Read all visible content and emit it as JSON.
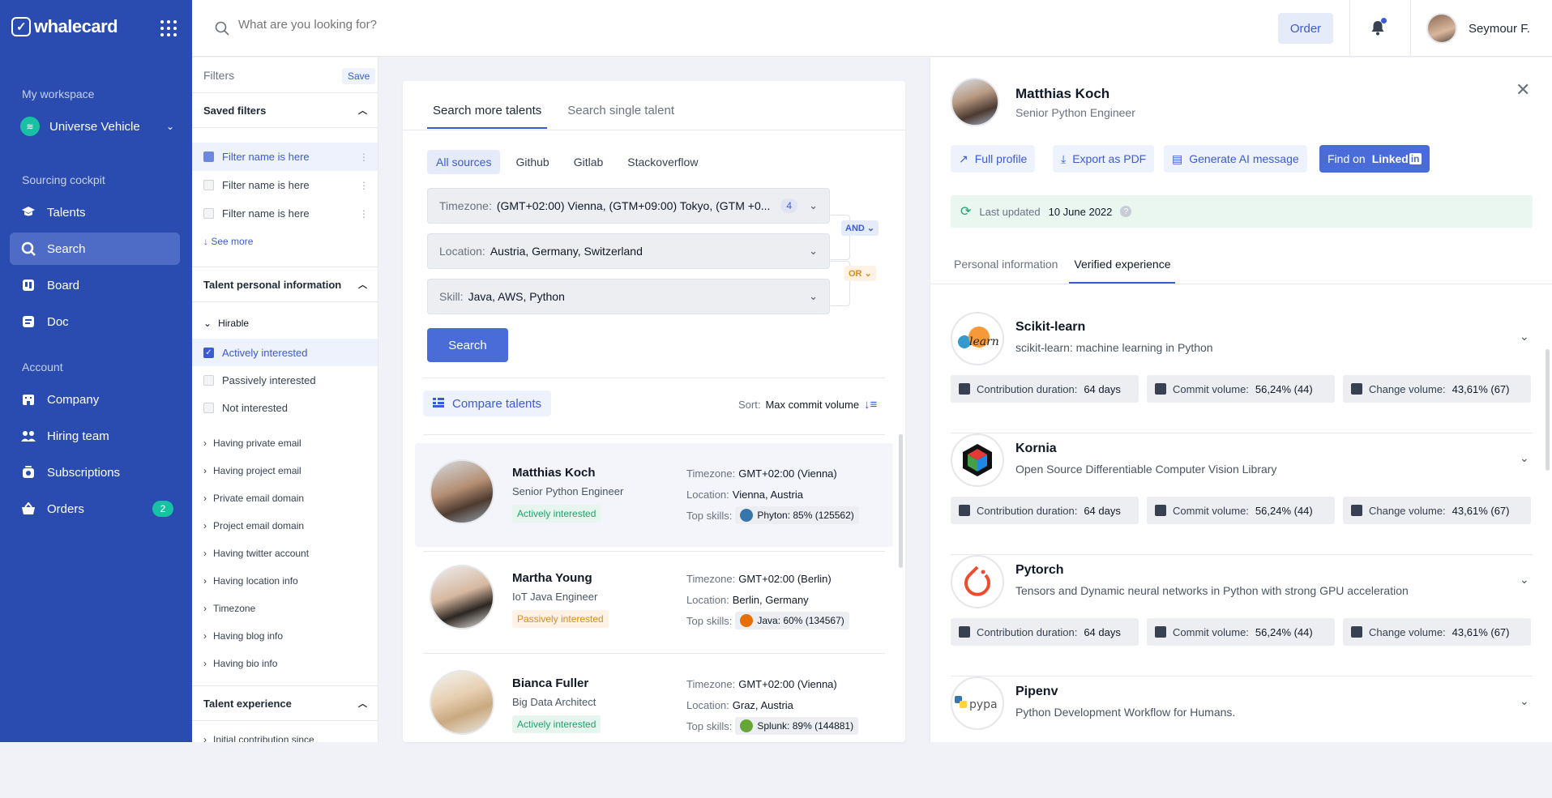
{
  "app": {
    "name": "whalecard"
  },
  "sidebar": {
    "section_workspace": "My workspace",
    "workspace": "Universe Vehicle",
    "section_sourcing": "Sourcing cockpit",
    "items": [
      {
        "label": "Talents",
        "icon": "graduation-cap-icon"
      },
      {
        "label": "Search",
        "icon": "search-icon"
      },
      {
        "label": "Board",
        "icon": "board-icon"
      },
      {
        "label": "Doc",
        "icon": "doc-icon"
      }
    ],
    "section_account": "Account",
    "account_items": [
      {
        "label": "Company",
        "icon": "building-icon"
      },
      {
        "label": "Hiring team",
        "icon": "team-icon"
      },
      {
        "label": "Subscriptions",
        "icon": "subscriptions-icon"
      },
      {
        "label": "Orders",
        "icon": "basket-icon",
        "badge": "2"
      }
    ]
  },
  "topbar": {
    "search_placeholder": "What are you looking for?",
    "order_label": "Order",
    "user_name": "Seymour F."
  },
  "filters": {
    "title": "Filters",
    "save_label": "Save",
    "saved_filters_title": "Saved filters",
    "saved": [
      "Filter name is here",
      "Filter name is here",
      "Filter name is here"
    ],
    "see_more": "See more",
    "personal_title": "Talent personal information",
    "hirable_label": "Hirable",
    "hirable_options": [
      "Actively interested",
      "Passively interested",
      "Not interested"
    ],
    "sub_filters": [
      "Having private email",
      "Having project email",
      "Private email domain",
      "Project email domain",
      "Having twitter account",
      "Having location info",
      "Timezone",
      "Having blog info",
      "Having bio info"
    ],
    "experience_title": "Talent experience",
    "experience_first": "Initial contribution since"
  },
  "search": {
    "tabs": [
      "Search more talents",
      "Search single talent"
    ],
    "sources": [
      "All sources",
      "Github",
      "Gitlab",
      "Stackoverflow"
    ],
    "timezone_label": "Timezone:",
    "timezone_value": "(GMT+02:00) Vienna, (GTM+09:00) Tokyo, (GTM +0...",
    "timezone_count": "4",
    "location_label": "Location:",
    "location_value": "Austria, Germany, Switzerland",
    "skill_label": "Skill:",
    "skill_value": "Java, AWS, Python",
    "and_label": "AND",
    "or_label": "OR",
    "search_button": "Search",
    "compare_label": "Compare talents",
    "sort_label": "Sort:",
    "sort_value": "Max commit volume"
  },
  "talent_labels": {
    "timezone": "Timezone:",
    "location": "Location:",
    "top_skills": "Top skills:"
  },
  "talents": [
    {
      "name": "Matthias Koch",
      "role": "Senior Python Engineer",
      "status": "Actively interested",
      "timezone": "GMT+02:00 (Vienna)",
      "location": "Vienna, Austria",
      "skill": "Phyton: 85% (125562)",
      "skill_color": "#3776ab"
    },
    {
      "name": "Martha Young",
      "role": "IoT Java Engineer",
      "status": "Passively interested",
      "timezone": "GMT+02:00 (Berlin)",
      "location": "Berlin, Germany",
      "skill": "Java: 60% (134567)",
      "skill_color": "#e76f00"
    },
    {
      "name": "Bianca Fuller",
      "role": "Big Data Architect",
      "status": "Actively interested",
      "timezone": "GMT+02:00 (Vienna)",
      "location": "Graz, Austria",
      "skill": "Splunk: 89% (144881)",
      "skill_color": "#65a637"
    }
  ],
  "detail": {
    "name": "Matthias Koch",
    "role": "Senior Python Engineer",
    "actions": [
      "Full profile",
      "Export as PDF",
      "Generate AI message"
    ],
    "find_on": "Find on",
    "linkedin_word": "Linked",
    "linkedin_in": "in",
    "updated_label": "Last updated",
    "updated_value": "10 June 2022",
    "tabs": [
      "Personal information",
      "Verified experience"
    ],
    "metric_labels": {
      "duration": "Contribution duration:",
      "commit": "Commit volume:",
      "change": "Change volume:"
    },
    "repos": [
      {
        "name": "Scikit-learn",
        "desc": "scikit-learn: machine learning in Python",
        "duration": "64 days",
        "commit": "56,24% (44)",
        "change": "43,61% (67)",
        "logo_text": "learn"
      },
      {
        "name": "Kornia",
        "desc": "Open Source Differentiable Computer Vision Library",
        "duration": "64 days",
        "commit": "56,24% (44)",
        "change": "43,61% (67)"
      },
      {
        "name": "Pytorch",
        "desc": "Tensors and Dynamic neural networks in Python with strong GPU acceleration",
        "duration": "64 days",
        "commit": "56,24% (44)",
        "change": "43,61% (67)"
      },
      {
        "name": "Pipenv",
        "desc": "Python Development Workflow for Humans.",
        "logo_text": "pypa"
      }
    ]
  }
}
